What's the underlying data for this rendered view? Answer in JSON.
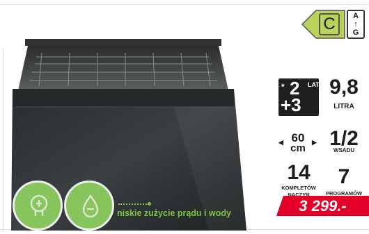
{
  "energy": {
    "class": "C",
    "scale_top": "A",
    "scale_arrow": "↑",
    "scale_bottom": "G",
    "class_color": "#b8d35a"
  },
  "product": {
    "eco_claim": "niskie zużycie prądu i wody"
  },
  "specs": {
    "warranty": {
      "star": "*",
      "years_a": "2",
      "years_b": "+3",
      "label": "LATA"
    },
    "water": {
      "value": "9,8",
      "unit": "LITRA"
    },
    "width": {
      "arrow_left": "◀",
      "arrow_right": "▶",
      "value": "60",
      "unit": "cm"
    },
    "load": {
      "value": "1/2",
      "unit": "WSADU"
    },
    "place_settings": {
      "value": "14",
      "unit_line1": "KOMPLETÓW",
      "unit_line2": "NACZYŃ"
    },
    "programs": {
      "value": "7",
      "unit": "PROGRAMÓW"
    }
  },
  "price": {
    "value": "3 299.-",
    "color": "#e4002b"
  },
  "colors": {
    "eco_green": "#7cc43e",
    "tile_dark": "#1f1f1f"
  }
}
